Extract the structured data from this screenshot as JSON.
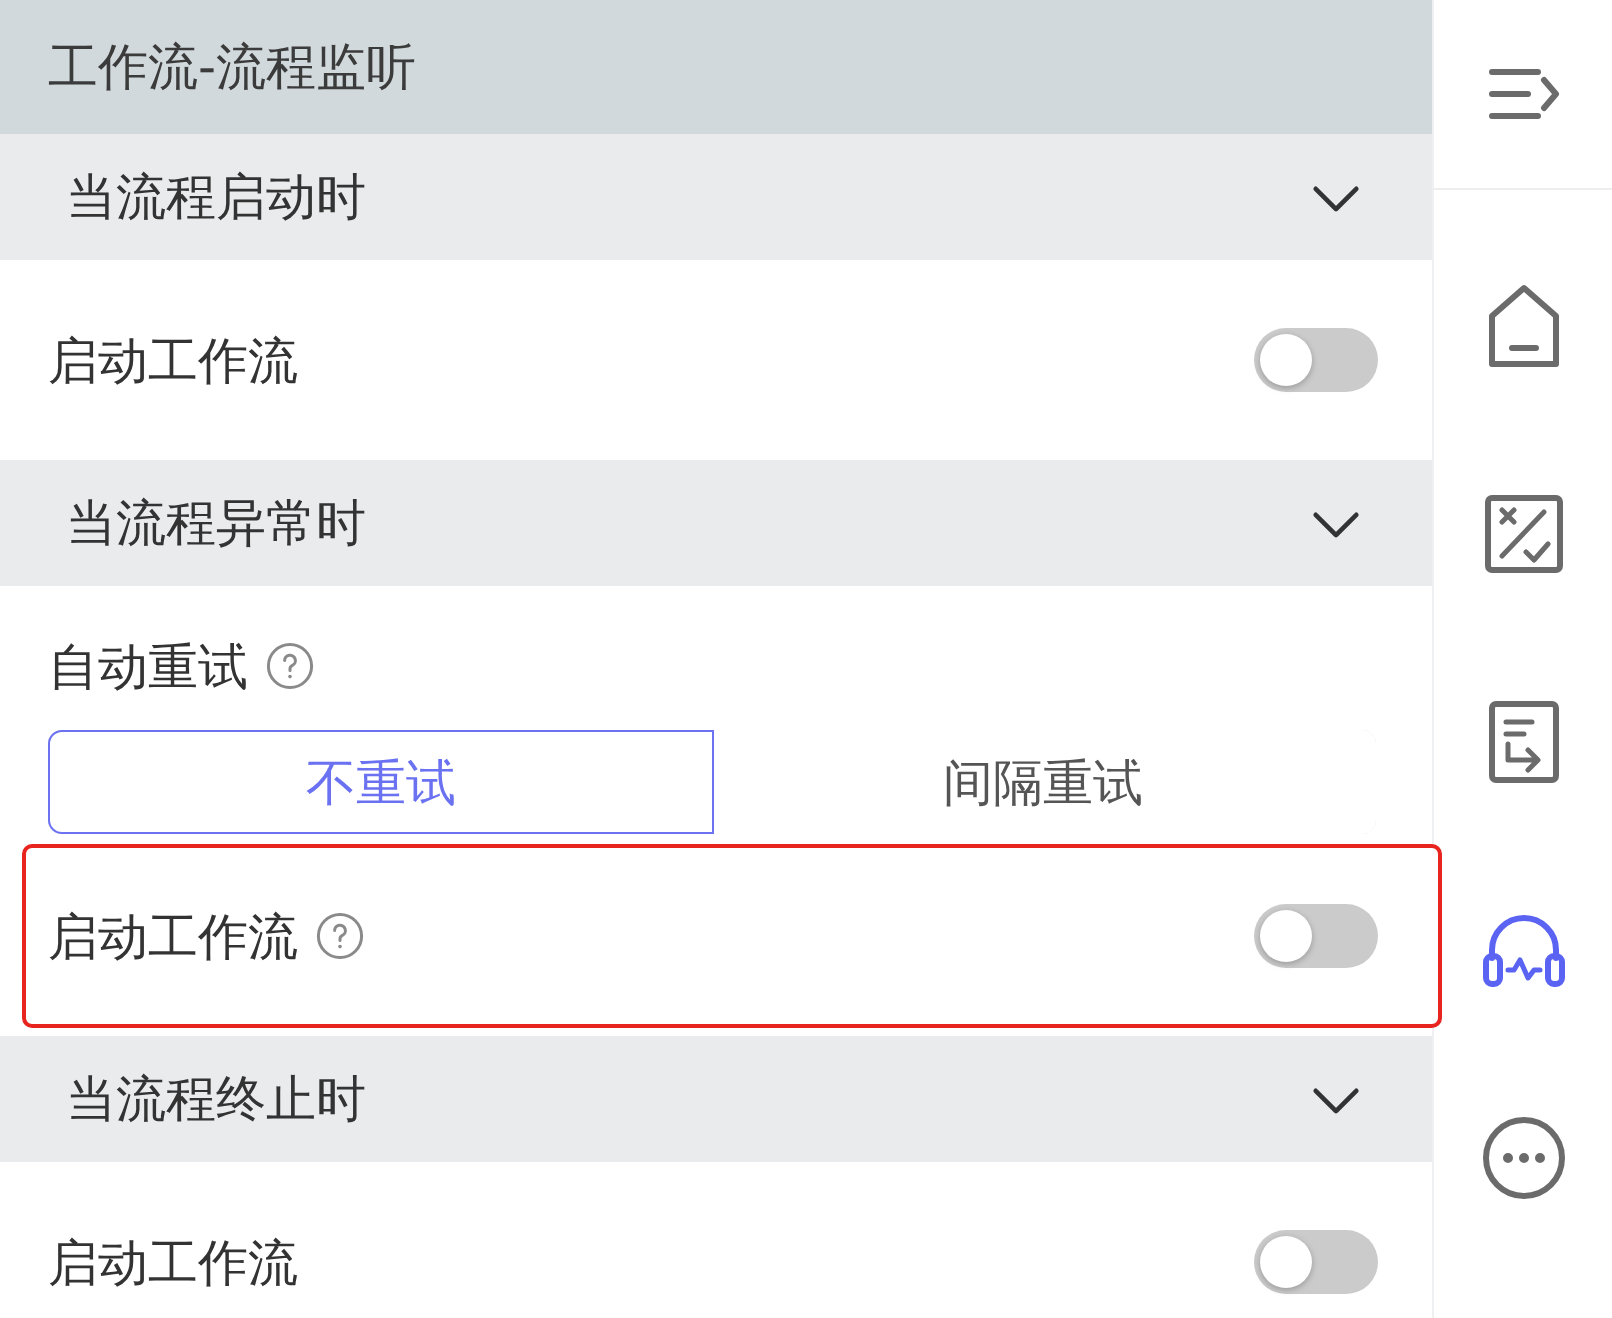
{
  "panel": {
    "title": "工作流-流程监听",
    "sections": [
      {
        "title": "当流程启动时",
        "expanded": true,
        "items": [
          {
            "kind": "toggle",
            "label": "启动工作流",
            "help": false,
            "highlighted": false,
            "on": false
          }
        ]
      },
      {
        "title": "当流程异常时",
        "expanded": true,
        "items": [
          {
            "kind": "choice",
            "label": "自动重试",
            "help": true,
            "options": [
              {
                "label": "不重试",
                "selected": true
              },
              {
                "label": "间隔重试",
                "selected": false
              }
            ]
          },
          {
            "kind": "toggle",
            "label": "启动工作流",
            "help": true,
            "highlighted": true,
            "on": false
          }
        ]
      },
      {
        "title": "当流程终止时",
        "expanded": true,
        "items": [
          {
            "kind": "toggle",
            "label": "启动工作流",
            "help": false,
            "highlighted": false,
            "on": false
          }
        ]
      }
    ]
  },
  "sidebar": {
    "items": [
      {
        "selected": false
      },
      {
        "selected": false
      },
      {
        "selected": false
      },
      {
        "selected": true
      },
      {
        "selected": false
      }
    ]
  }
}
